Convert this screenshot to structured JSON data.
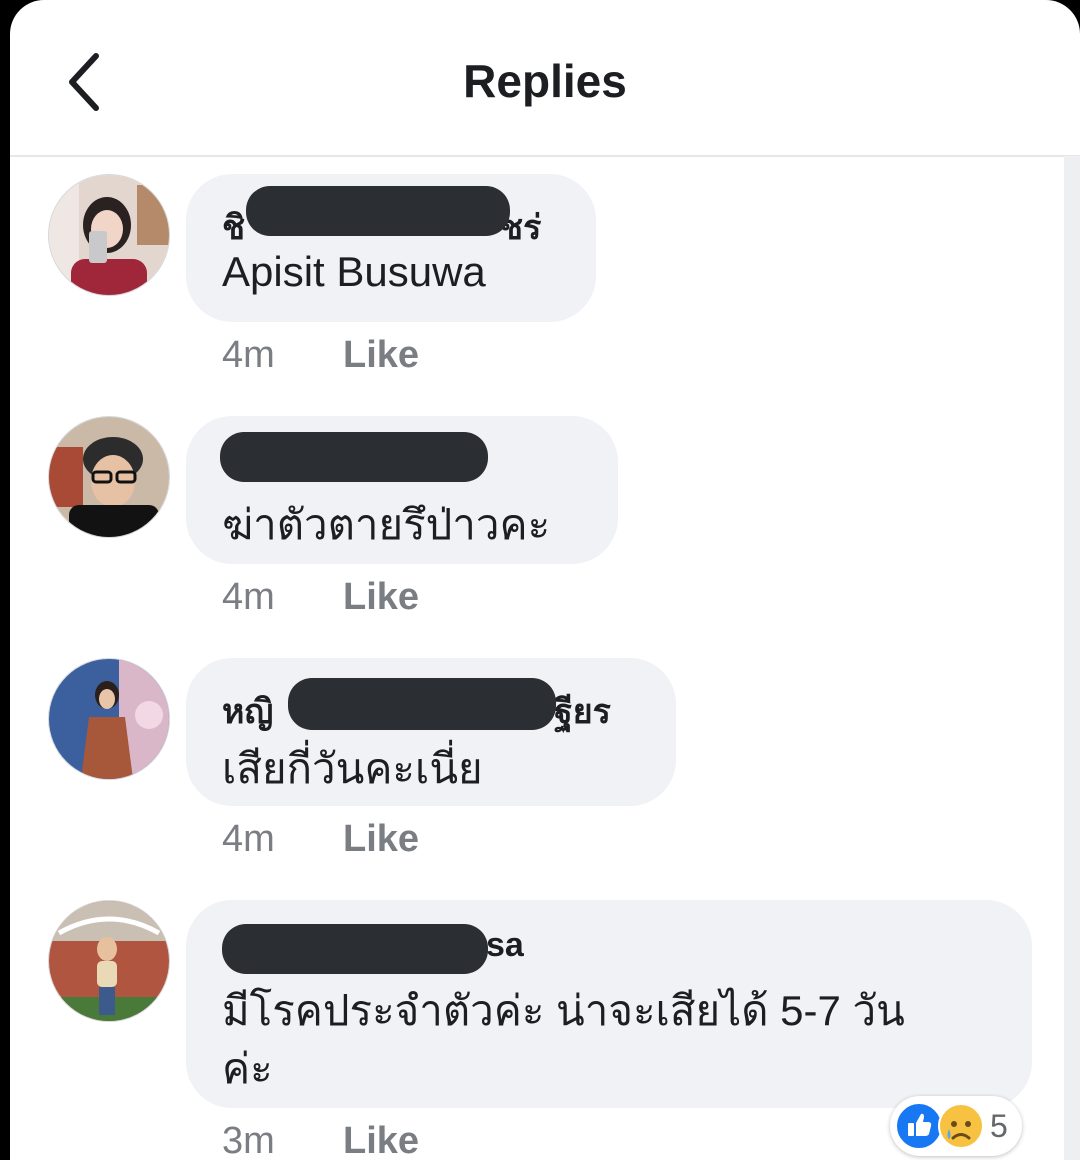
{
  "header": {
    "title": "Replies"
  },
  "replies": [
    {
      "name_visible_start": "ชิ",
      "name_visible_end": "ชร่",
      "text": "Apisit Busuwa",
      "time": "4m",
      "like": "Like"
    },
    {
      "name_visible_start": "",
      "name_visible_end": "",
      "text": "ฆ่าตัวตายรึป่าวคะ",
      "time": "4m",
      "like": "Like"
    },
    {
      "name_visible_start": "หญิ",
      "name_visible_end": "ฐียร",
      "text": "เสียกี่วันคะเนี่ย",
      "time": "4m",
      "like": "Like"
    },
    {
      "name_visible_start": "",
      "name_visible_end": "sa",
      "text_line1": "มีโรคประจำตัวค่ะ น่าจะเสียได้ 5-7 วัน",
      "text_line2": "ค่ะ",
      "time": "3m",
      "like": "Like",
      "reaction_count": "5"
    }
  ],
  "colors": {
    "bubble": "#f0f2f5",
    "like_blue": "#1877f2",
    "meta_gray": "#7a7d82",
    "text": "#1c1e21"
  }
}
